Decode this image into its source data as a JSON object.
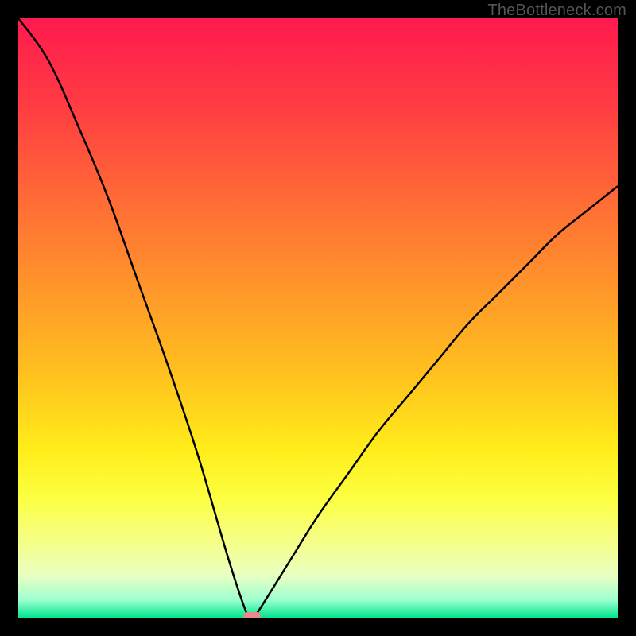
{
  "watermark": "TheBottleneck.com",
  "chart_data": {
    "type": "line",
    "title": "",
    "xlabel": "",
    "ylabel": "",
    "xlim": [
      0,
      100
    ],
    "ylim": [
      0,
      100
    ],
    "background": {
      "type": "vertical-gradient",
      "stops": [
        {
          "pos": 0.0,
          "color": "#ff1a4f"
        },
        {
          "pos": 0.15,
          "color": "#ff3d42"
        },
        {
          "pos": 0.3,
          "color": "#ff6a36"
        },
        {
          "pos": 0.45,
          "color": "#ff962a"
        },
        {
          "pos": 0.6,
          "color": "#ffc31e"
        },
        {
          "pos": 0.72,
          "color": "#ffed1a"
        },
        {
          "pos": 0.8,
          "color": "#fcff40"
        },
        {
          "pos": 0.88,
          "color": "#f4ff8e"
        },
        {
          "pos": 0.93,
          "color": "#e8ffc2"
        },
        {
          "pos": 0.97,
          "color": "#9effd0"
        },
        {
          "pos": 1.0,
          "color": "#00e48c"
        }
      ]
    },
    "series": [
      {
        "name": "bottleneck-curve",
        "color": "#000000",
        "x": [
          0,
          5,
          10,
          15,
          20,
          25,
          30,
          35,
          38,
          39,
          40,
          45,
          50,
          55,
          60,
          65,
          70,
          75,
          80,
          85,
          90,
          95,
          100
        ],
        "y": [
          100,
          93,
          82,
          70,
          56,
          42,
          27,
          10,
          1,
          0,
          1,
          9,
          17,
          24,
          31,
          37,
          43,
          49,
          54,
          59,
          64,
          68,
          72
        ]
      }
    ],
    "marker": {
      "name": "optimal-point",
      "x": 39,
      "y": 0,
      "color": "#e88a8a",
      "shape": "rounded-rect"
    }
  }
}
